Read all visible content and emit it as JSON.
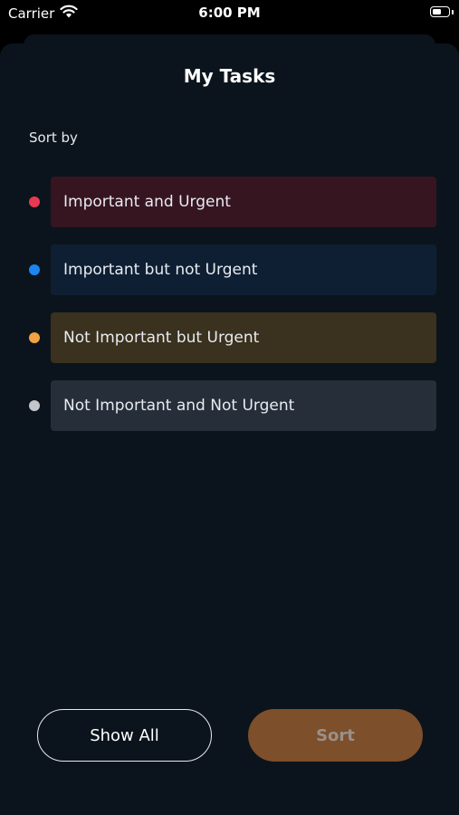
{
  "status_bar": {
    "carrier": "Carrier",
    "time": "6:00 PM",
    "wifi_icon": "wifi-icon",
    "battery_icon": "battery-icon"
  },
  "sheet": {
    "title": "My Tasks",
    "sort_label": "Sort by"
  },
  "options": [
    {
      "label": "Important and Urgent",
      "dot_color": "#e63a52",
      "bg_color": "#361521"
    },
    {
      "label": "Important but not Urgent",
      "dot_color": "#1b86f0",
      "bg_color": "#0e1f33"
    },
    {
      "label": "Not Important but Urgent",
      "dot_color": "#f0a340",
      "bg_color": "#3a311e"
    },
    {
      "label": "Not Important and Not Urgent",
      "dot_color": "#c2c5c9",
      "bg_color": "#252e39"
    }
  ],
  "buttons": {
    "show_all": "Show All",
    "sort": "Sort"
  },
  "colors": {
    "sheet_background": "#0b141c",
    "sort_button": "#7d4f2a"
  }
}
